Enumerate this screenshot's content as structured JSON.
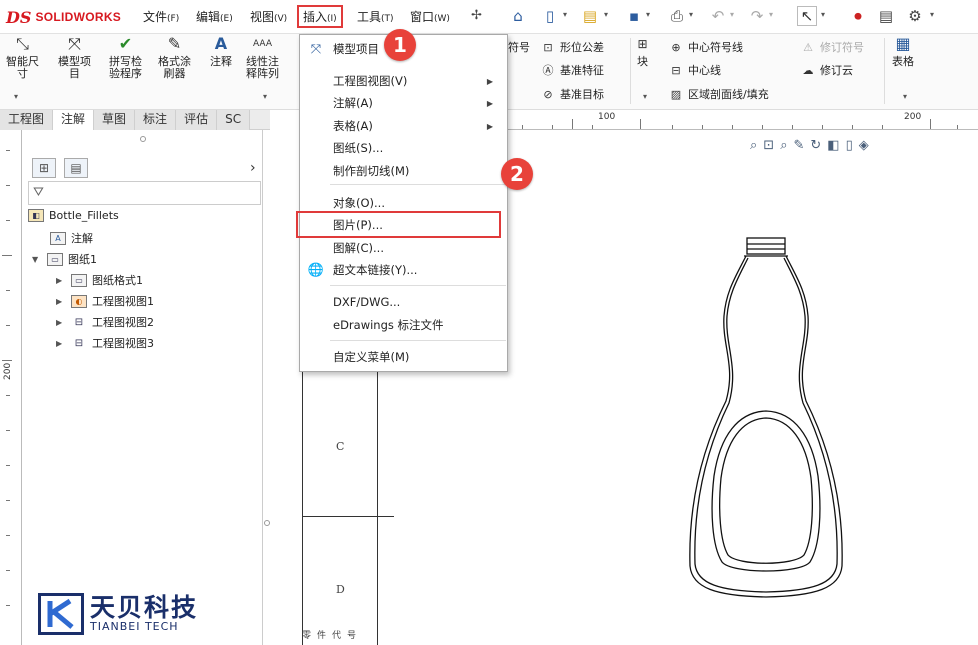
{
  "app": {
    "logo_ds": "DS",
    "logo_name": "SOLIDWORKS"
  },
  "menubar": {
    "items": [
      {
        "label": "文件",
        "accel": "(F)"
      },
      {
        "label": "编辑",
        "accel": "(E)"
      },
      {
        "label": "视图",
        "accel": "(V)"
      },
      {
        "label": "插入",
        "accel": "(I)"
      },
      {
        "label": "工具",
        "accel": "(T)"
      },
      {
        "label": "窗口",
        "accel": "(W)"
      }
    ]
  },
  "ribbon": {
    "smart_dim": "智能尺\n寸",
    "model_items": "模型项\n目",
    "spell_check": "拼写检\n验程序",
    "format_painter": "格式涂\n刷器",
    "note": "注释",
    "linear_pattern": "线性注\n释阵列",
    "symbol_tail": "符号",
    "gtol": "形位公差",
    "datum_feature": "基准特征",
    "datum_target": "基准目标",
    "block": "块",
    "center_mark": "中心符号线",
    "centerline": "中心线",
    "area_hatch": "区域剖面线/填充",
    "revision_symbol": "修订符号",
    "revision_cloud": "修订云",
    "table": "表格"
  },
  "tabs": [
    "工程图",
    "注解",
    "草图",
    "标注",
    "评估",
    "SC"
  ],
  "active_tab": 1,
  "feature_tree": {
    "root": "Bottle_Fillets",
    "items": [
      {
        "label": "注解",
        "indent": 1
      },
      {
        "label": "图纸1",
        "indent": 1
      },
      {
        "label": "图纸格式1",
        "indent": 2
      },
      {
        "label": "工程图视图1",
        "indent": 2
      },
      {
        "label": "工程图视图2",
        "indent": 2
      },
      {
        "label": "工程图视图3",
        "indent": 2
      }
    ]
  },
  "ruler": {
    "h_100": "100",
    "h_200": "200",
    "v_200": "200"
  },
  "drawing": {
    "zone_c": "C",
    "zone_d": "D",
    "title_strip": "零件代号"
  },
  "insert_menu": {
    "items": [
      {
        "label": "模型项目",
        "icon": "model-items-icon"
      },
      {
        "label": "工程图视图(V)",
        "submenu": true
      },
      {
        "label": "注解(A)",
        "submenu": true
      },
      {
        "label": "表格(A)",
        "submenu": true
      },
      {
        "label": "图纸(S)..."
      },
      {
        "label": "制作剖切线(M)"
      },
      {
        "label": "对象(O)..."
      },
      {
        "label": "图片(P)..."
      },
      {
        "label": "图解(C)..."
      },
      {
        "label": "超文本链接(Y)...",
        "icon": "hyperlink-icon"
      },
      {
        "label": "DXF/DWG..."
      },
      {
        "label": "eDrawings 标注文件"
      },
      {
        "label": "自定义菜单(M)"
      }
    ],
    "highlighted": "图片(P)..."
  },
  "steps": [
    "1",
    "2"
  ],
  "watermark": {
    "cn": "天贝科技",
    "en": "TIANBEI TECH"
  },
  "colors": {
    "accent_red": "#e8423a",
    "brand_red": "#d71920",
    "watermark_blue": "#1a2f6a"
  }
}
